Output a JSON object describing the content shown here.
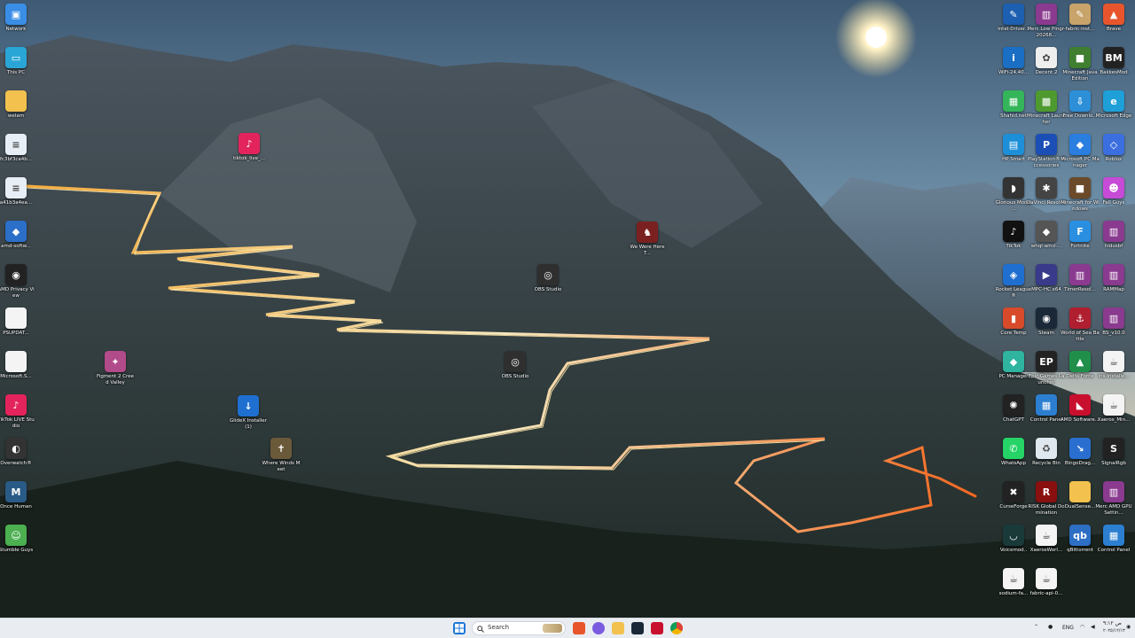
{
  "desktop": {
    "left_icons": [
      {
        "name": "network-icon",
        "label": "Network",
        "glyph": "▣",
        "color": "#3a8ee6"
      },
      {
        "name": "this-pc-icon",
        "label": "This PC",
        "glyph": "▭",
        "color": "#2aa6d6"
      },
      {
        "name": "folder-icon",
        "label": "welam",
        "glyph": "",
        "color": "#f2c14e"
      },
      {
        "name": "file-icon",
        "label": "fc3bf3ca4b...",
        "glyph": "≡",
        "color": "#e8eef5"
      },
      {
        "name": "file-icon",
        "label": "a41b3a4ea...",
        "glyph": "≡",
        "color": "#e8eef5"
      },
      {
        "name": "amd-software-icon",
        "label": "amd-softw...",
        "glyph": "◆",
        "color": "#2b6fc9"
      },
      {
        "name": "amd-privacy-icon",
        "label": "AMD Privacy View",
        "glyph": "◉",
        "color": "#222"
      },
      {
        "name": "document-icon",
        "label": "PSUPDAT...",
        "glyph": "",
        "color": "#f4f4f4"
      },
      {
        "name": "document-icon",
        "label": "Microsoft.S...",
        "glyph": "",
        "color": "#f4f4f4"
      },
      {
        "name": "tiktok-live-icon",
        "label": "TikTok LIVE Studio",
        "glyph": "♪",
        "color": "#e3245c"
      },
      {
        "name": "overwatch-icon",
        "label": "Overwatch®",
        "glyph": "◐",
        "color": "#333"
      },
      {
        "name": "once-human-icon",
        "label": "Once Human",
        "glyph": "M",
        "color": "#2a5b86"
      },
      {
        "name": "stumble-guys-icon",
        "label": "Stumble Guys",
        "glyph": "☺",
        "color": "#4caf50"
      }
    ],
    "scattered_icons": [
      {
        "name": "tiktok-live-shortcut-icon",
        "label": "tiktok_live_...",
        "glyph": "♪",
        "color": "#e3245c"
      },
      {
        "name": "figment-icon",
        "label": "Figment 2 Creed Valley",
        "glyph": "✦",
        "color": "#b24b8a"
      },
      {
        "name": "glidex-installer-icon",
        "label": "GlideX Installer (1)",
        "glyph": "↓",
        "color": "#1f6fd1"
      },
      {
        "name": "where-winds-meet-icon",
        "label": "Where Winds Meet",
        "glyph": "✝",
        "color": "#6b5a3a"
      },
      {
        "name": "obs-studio-icon",
        "label": "OBS Studio",
        "glyph": "◎",
        "color": "#2f2f2f"
      },
      {
        "name": "obs-studio-icon",
        "label": "OBS Studio",
        "glyph": "◎",
        "color": "#2f2f2f"
      },
      {
        "name": "we-were-here-icon",
        "label": "We Were Here T...",
        "glyph": "♞",
        "color": "#7a2020"
      }
    ],
    "right_icons": [
      {
        "name": "intel-driver-icon",
        "label": "Intel-Driver...",
        "glyph": "✎",
        "color": "#1d5fb0"
      },
      {
        "name": "winrar-icon",
        "label": "Merc Low Pingr-20268...",
        "glyph": "▥",
        "color": "#8a3a8f"
      },
      {
        "name": "fabric-icon",
        "label": "fabric-inst...",
        "glyph": "✎",
        "color": "#c8a36a"
      },
      {
        "name": "brave-icon",
        "label": "Brave",
        "glyph": "▲",
        "color": "#e8552c"
      },
      {
        "name": "intel-wifi-icon",
        "label": "WiFi-24.40...",
        "glyph": "i",
        "color": "#1a6ec4"
      },
      {
        "name": "decent-icon",
        "label": "Decent 2",
        "glyph": "✿",
        "color": "#eeeeee"
      },
      {
        "name": "minecraft-java-icon",
        "label": "Minecraft Java Edition",
        "glyph": "■",
        "color": "#3f7f2f"
      },
      {
        "name": "bakkesmod-icon",
        "label": "BakkesMod",
        "glyph": "BM",
        "color": "#222"
      },
      {
        "name": "shahid-icon",
        "label": "Shahid.net",
        "glyph": "▦",
        "color": "#34b55a"
      },
      {
        "name": "minecraft-launcher-icon",
        "label": "Minecraft Launcher",
        "glyph": "▩",
        "color": "#4f9a2f"
      },
      {
        "name": "free-download-icon",
        "label": "Free Downlo...",
        "glyph": "⇩",
        "color": "#2c8fd8"
      },
      {
        "name": "edge-icon",
        "label": "Microsoft Edge",
        "glyph": "e",
        "color": "#1e9fd8"
      },
      {
        "name": "hp-smart-icon",
        "label": "HP Smart",
        "glyph": "▤",
        "color": "#1d8fd8"
      },
      {
        "name": "playstation-icon",
        "label": "PlayStation® Accessories",
        "glyph": "P",
        "color": "#1b4fb6"
      },
      {
        "name": "microsoft-pc-manager-icon",
        "label": "Microsoft PC Manager",
        "glyph": "◆",
        "color": "#2a7ee0"
      },
      {
        "name": "roblox-icon",
        "label": "Roblox",
        "glyph": "◇",
        "color": "#3b6fe0"
      },
      {
        "name": "glorious-icon",
        "label": "Glorious Model ...",
        "glyph": "◗",
        "color": "#333"
      },
      {
        "name": "davinci-resolve-icon",
        "label": "DaVinci Resolve",
        "glyph": "✱",
        "color": "#444"
      },
      {
        "name": "minecraft-windows-icon",
        "label": "Minecraft for Windows",
        "glyph": "■",
        "color": "#6b4a2a"
      },
      {
        "name": "fall-guys-icon",
        "label": "Fall Guys",
        "glyph": "☻",
        "color": "#c64bd6"
      },
      {
        "name": "tiktok-icon",
        "label": "TikTok",
        "glyph": "♪",
        "color": "#111"
      },
      {
        "name": "whql-amd-icon",
        "label": "whql-amd-...",
        "glyph": "◆",
        "color": "#555"
      },
      {
        "name": "fortnite-icon",
        "label": "Fortnite",
        "glyph": "F",
        "color": "#2a8fe0"
      },
      {
        "name": "winrar-icon",
        "label": "hidusbf",
        "glyph": "▥",
        "color": "#8a3a8f"
      },
      {
        "name": "rocket-league-icon",
        "label": "Rocket League®",
        "glyph": "◈",
        "color": "#1f6fd1"
      },
      {
        "name": "mpc-hc-icon",
        "label": "MPC-HC x64",
        "glyph": "▶",
        "color": "#3a3a8a"
      },
      {
        "name": "winrar-icon",
        "label": "TimerResol...",
        "glyph": "▥",
        "color": "#8a3a8f"
      },
      {
        "name": "winrar-icon",
        "label": "RAMMap",
        "glyph": "▥",
        "color": "#8a3a8f"
      },
      {
        "name": "core-temp-icon",
        "label": "Core Temp",
        "glyph": "▮",
        "color": "#d84a2a"
      },
      {
        "name": "steam-icon",
        "label": "Steam",
        "glyph": "◉",
        "color": "#1b2838"
      },
      {
        "name": "world-of-sea-battle-icon",
        "label": "World of Sea Battle",
        "glyph": "⚓",
        "color": "#b01f2f"
      },
      {
        "name": "winrar-icon",
        "label": "BS_v10.0",
        "glyph": "▥",
        "color": "#8a3a8f"
      },
      {
        "name": "pc-manager-icon",
        "label": "PC Manager",
        "glyph": "◆",
        "color": "#2fb4a0"
      },
      {
        "name": "epic-games-icon",
        "label": "Epic Games Launcher",
        "glyph": "EP",
        "color": "#222"
      },
      {
        "name": "delta-force-icon",
        "label": "Delta Force",
        "glyph": "▲",
        "color": "#1f8f4a"
      },
      {
        "name": "java-installer-icon",
        "label": "Ins-Installe...",
        "glyph": "☕",
        "color": "#f4f4f4"
      },
      {
        "name": "chatgpt-icon",
        "label": "ChatGPT",
        "glyph": "✺",
        "color": "#222"
      },
      {
        "name": "control-panel-icon",
        "label": "Control Panel",
        "glyph": "▦",
        "color": "#2c7fd0"
      },
      {
        "name": "amd-software-icon",
        "label": "AMD Software...",
        "glyph": "◣",
        "color": "#c8102e"
      },
      {
        "name": "java-file-icon",
        "label": "Xaeros_Min...",
        "glyph": "☕",
        "color": "#f4f4f4"
      },
      {
        "name": "whatsapp-icon",
        "label": "WhatsApp",
        "glyph": "✆",
        "color": "#25d366"
      },
      {
        "name": "recycle-bin-icon",
        "label": "Recycle Bin",
        "glyph": "♻",
        "color": "#dfe8ef"
      },
      {
        "name": "bingo-icon",
        "label": "BingoDrag...",
        "glyph": "↘",
        "color": "#2a6fd0"
      },
      {
        "name": "signalrgb-icon",
        "label": "SignalRgb",
        "glyph": "S",
        "color": "#222"
      },
      {
        "name": "curseforge-icon",
        "label": "CurseForge",
        "glyph": "✖",
        "color": "#222"
      },
      {
        "name": "risk-icon",
        "label": "RISK Global Domination",
        "glyph": "R",
        "color": "#8a1010"
      },
      {
        "name": "folder-icon",
        "label": "DualSense...",
        "glyph": "",
        "color": "#f2c14e"
      },
      {
        "name": "winrar-icon",
        "label": "Merc AMD GPU Settin...",
        "glyph": "▥",
        "color": "#8a3a8f"
      },
      {
        "name": "voicemod-icon",
        "label": "Voicemod..",
        "glyph": "◡",
        "color": "#1a3a3a"
      },
      {
        "name": "java-file-icon",
        "label": "XaerosWorl...",
        "glyph": "☕",
        "color": "#f4f4f4"
      },
      {
        "name": "qbittorrent-icon",
        "label": "qBittorrent",
        "glyph": "qb",
        "color": "#2d6fc4"
      },
      {
        "name": "control-panel-icon",
        "label": "Control Panel",
        "glyph": "▦",
        "color": "#2c7fd0"
      },
      {
        "name": "java-file-icon",
        "label": "sodium-fa...",
        "glyph": "☕",
        "color": "#f4f4f4"
      },
      {
        "name": "java-file-icon",
        "label": "fabric-api-0...",
        "glyph": "☕",
        "color": "#f4f4f4"
      }
    ]
  },
  "taskbar": {
    "search_placeholder": "Search",
    "language": "ENG",
    "time": "ص ٩:١٢",
    "date": "٢٠٢٥/١٢/١٣",
    "accent": "#e9edf2"
  }
}
